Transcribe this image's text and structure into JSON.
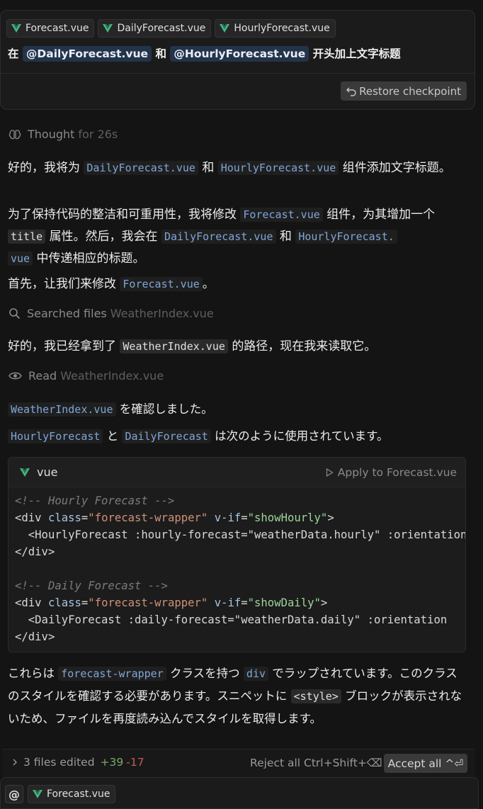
{
  "colors": {
    "vue_green": "#41b883",
    "accent_blue": "#7fa6d8",
    "added": "#7aa86a",
    "removed": "#c05b5b"
  },
  "user_message": {
    "chips": [
      "Forecast.vue",
      "DailyForecast.vue",
      "HourlyForecast.vue"
    ],
    "prompt": {
      "prefix": "在",
      "mention1": "@DailyForecast.vue",
      "joiner": "和",
      "mention2": "@HourlyForecast.vue",
      "suffix": "开头加上文字标题"
    },
    "restore_label": "Restore checkpoint"
  },
  "thought": {
    "label": "Thought",
    "duration": "for 26s",
    "icon": "brain-icon"
  },
  "p1": {
    "t1": "好的，我将为",
    "c1": "DailyForecast.vue",
    "t2": "和",
    "c2": "HourlyForecast.vue",
    "t3": "组件添加文字标题。"
  },
  "p2": {
    "t1": "为了保持代码的整洁和可重用性，我将修改",
    "c1": "Forecast.vue",
    "t2": "组件，为其增加一个",
    "c2": "title",
    "t3": "属性。然后，我会在",
    "c3": "DailyForecast.vue",
    "t4": "和",
    "c4a": "HourlyForecast.",
    "c4b": "vue",
    "t5": "中传递相应的标题。"
  },
  "p3": {
    "t1": "首先，让我们来修改",
    "c1": "Forecast.vue",
    "t2": "。"
  },
  "searched": {
    "label": "Searched files",
    "target": "WeatherIndex.vue",
    "icon": "search-icon"
  },
  "p4": {
    "t1": "好的，我已经拿到了",
    "c1": "WeatherIndex.vue",
    "t2": "的路径，现在我来读取它。"
  },
  "read": {
    "label": "Read",
    "target": "WeatherIndex.vue",
    "icon": "eye-icon"
  },
  "p5": {
    "c1": "WeatherIndex.vue",
    "t1": "を確認しました。"
  },
  "p6": {
    "c1": "HourlyForecast",
    "t1": "と",
    "c2": "DailyForecast",
    "t2": "は次のように使用されています。"
  },
  "code_block": {
    "lang": "vue",
    "apply_label": "Apply to Forecast.vue",
    "comment1": "<!-- Hourly Forecast -->",
    "div_open": "<div",
    "class_attr": "class",
    "class_val": "\"forecast-wrapper\"",
    "vif_attr": "v-if",
    "vif_val1": "\"showHourly\"",
    "gt": ">",
    "line3": "  <HourlyForecast :hourly-forecast=\"weatherData.hourly\" :orientation",
    "div_close": "</div>",
    "comment2": "<!-- Daily Forecast -->",
    "vif_val2": "\"showDaily\"",
    "line8": "  <DailyForecast :daily-forecast=\"weatherData.daily\" :orientation"
  },
  "p7": {
    "t1": "これらは",
    "c1": "forecast-wrapper",
    "t2": "クラスを持つ",
    "c2": "div",
    "t3": "でラップされています。このクラスのスタイルを確認する必要があります。スニペットに",
    "c3": "<style>",
    "t4": "ブロックが表示されないため、ファイルを再度読み込んでスタイルを取得します。"
  },
  "files_bar": {
    "summary": "3 files edited",
    "added": "+39",
    "removed": "-17",
    "reject_label": "Reject all Ctrl+Shift+⌫",
    "accept_label": "Accept all ^⏎"
  },
  "composer": {
    "at_label": "@",
    "context_file": "Forecast.vue"
  }
}
